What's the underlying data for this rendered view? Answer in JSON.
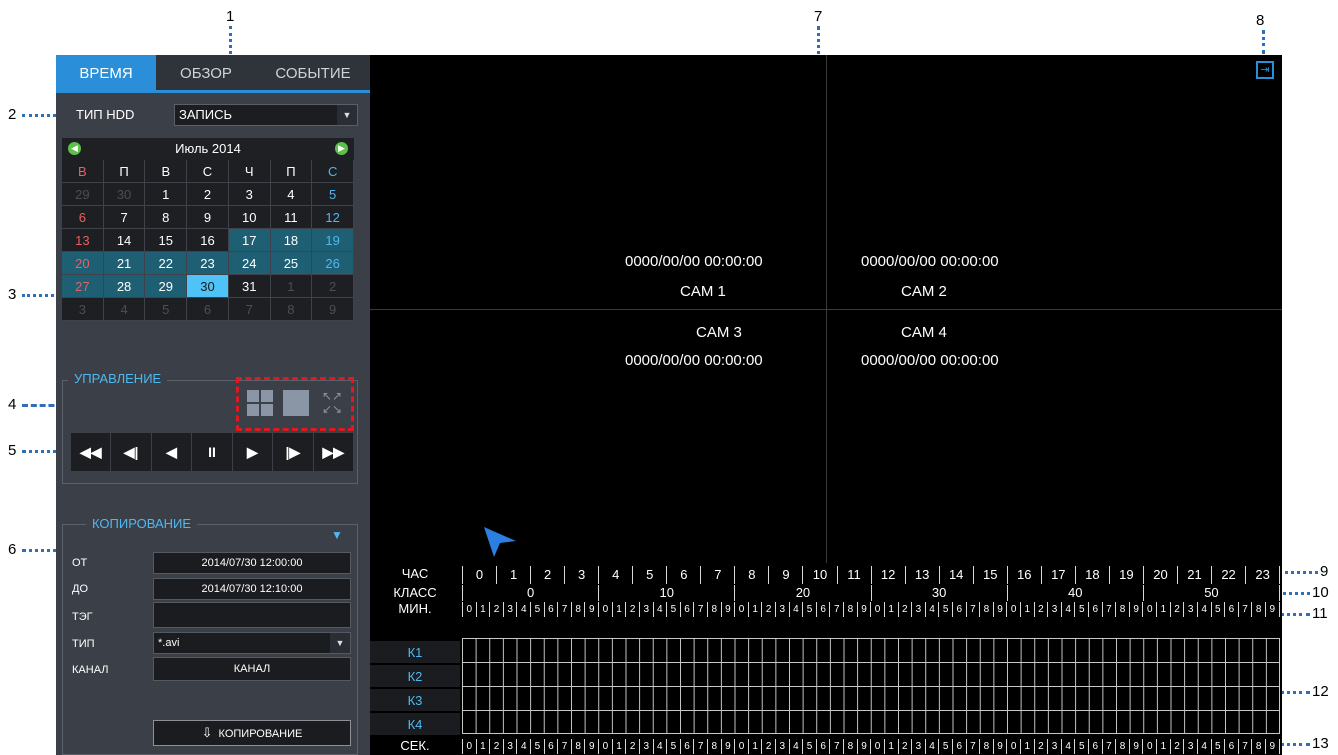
{
  "callouts": [
    "1",
    "2",
    "3",
    "4",
    "5",
    "6",
    "7",
    "8",
    "9",
    "10",
    "11",
    "12",
    "13"
  ],
  "tabs": [
    {
      "label": "ВРЕМЯ",
      "active": true
    },
    {
      "label": "ОБЗОР",
      "active": false
    },
    {
      "label": "СОБЫТИЕ",
      "active": false
    }
  ],
  "hdd": {
    "label": "ТИП HDD",
    "value": "ЗАПИСЬ"
  },
  "calendar": {
    "month_label": "Июль  2014",
    "day_names": [
      "В",
      "П",
      "В",
      "С",
      "Ч",
      "П",
      "С"
    ],
    "weeks": [
      [
        "29",
        "30",
        "1",
        "2",
        "3",
        "4",
        "5"
      ],
      [
        "6",
        "7",
        "8",
        "9",
        "10",
        "11",
        "12"
      ],
      [
        "13",
        "14",
        "15",
        "16",
        "17",
        "18",
        "19"
      ],
      [
        "20",
        "21",
        "22",
        "23",
        "24",
        "25",
        "26"
      ],
      [
        "27",
        "28",
        "29",
        "30",
        "31",
        "1",
        "2"
      ],
      [
        "3",
        "4",
        "5",
        "6",
        "7",
        "8",
        "9"
      ]
    ],
    "selected": "30"
  },
  "control": {
    "title": "УПРАВЛЕНИЕ"
  },
  "copy": {
    "title": "КОПИРОВАНИЕ",
    "from_label": "ОТ",
    "from_value": "2014/07/30 12:00:00",
    "to_label": "ДО",
    "to_value": "2014/07/30 12:10:00",
    "tag_label": "ТЭГ",
    "tag_value": "",
    "type_label": "ТИП",
    "type_value": "*.avi",
    "channel_label": "КАНАЛ",
    "channel_button": "КАНАЛ",
    "copy_button": "КОПИРОВАНИЕ"
  },
  "video": {
    "cams": [
      {
        "name": "CAM 1",
        "time": "0000/00/00 00:00:00"
      },
      {
        "name": "CAM 2",
        "time": "0000/00/00 00:00:00"
      },
      {
        "name": "CAM 3",
        "time": "0000/00/00 00:00:00"
      },
      {
        "name": "CAM 4",
        "time": "0000/00/00 00:00:00"
      }
    ]
  },
  "timeline": {
    "hour_label": "ЧАС",
    "hours": [
      "0",
      "1",
      "2",
      "3",
      "4",
      "5",
      "6",
      "7",
      "8",
      "9",
      "10",
      "11",
      "12",
      "13",
      "14",
      "15",
      "16",
      "17",
      "18",
      "19",
      "20",
      "21",
      "22",
      "23"
    ],
    "class_label": "КЛАСС",
    "classes": [
      "0",
      "10",
      "20",
      "30",
      "40",
      "50"
    ],
    "min_label": "МИН.",
    "sec_label": "СЕК.",
    "channels": [
      "К1",
      "К2",
      "К3",
      "К4"
    ]
  }
}
